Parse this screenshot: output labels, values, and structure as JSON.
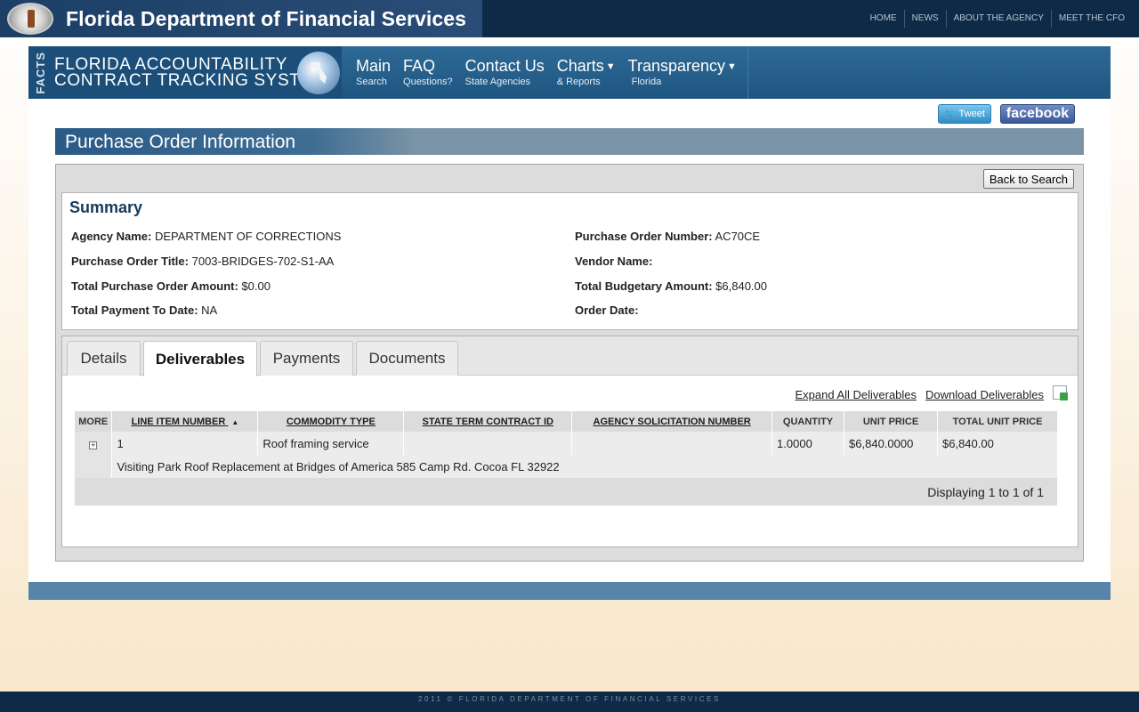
{
  "topbar": {
    "title": "Florida Department of Financial Services",
    "nav": [
      "HOME",
      "NEWS",
      "ABOUT THE AGENCY",
      "MEET THE CFO"
    ]
  },
  "facts": {
    "vertical_label": "FACTS",
    "title_line1": "FLORIDA ACCOUNTABILITY",
    "title_line2": "CONTRACT TRACKING SYSTEM"
  },
  "mainnav": [
    {
      "label": "Main",
      "sub": "Search"
    },
    {
      "label": "FAQ",
      "sub": "Questions?"
    },
    {
      "label": "Contact Us",
      "sub": "State Agencies"
    },
    {
      "label": "Charts",
      "sub": "& Reports"
    },
    {
      "label": "Transparency",
      "sub": "Florida"
    }
  ],
  "social": {
    "tweet": "Tweet",
    "facebook": "facebook"
  },
  "page_title": "Purchase Order Information",
  "back_button": "Back to Search",
  "summary": {
    "heading": "Summary",
    "agency_name_label": "Agency Name:",
    "agency_name": "DEPARTMENT OF CORRECTIONS",
    "po_number_label": "Purchase Order Number:",
    "po_number": "AC70CE",
    "po_title_label": "Purchase Order Title:",
    "po_title": "7003-BRIDGES-702-S1-AA",
    "vendor_label": "Vendor Name:",
    "vendor": "",
    "total_amount_label": "Total Purchase Order Amount:",
    "total_amount": "$0.00",
    "budgetary_label": "Total Budgetary Amount:",
    "budgetary": "$6,840.00",
    "payment_label": "Total Payment To Date:",
    "payment": "NA",
    "order_date_label": "Order Date:",
    "order_date": ""
  },
  "tabs": [
    "Details",
    "Deliverables",
    "Payments",
    "Documents"
  ],
  "active_tab": "Deliverables",
  "deliverables": {
    "expand_all": "Expand All Deliverables",
    "download": "Download Deliverables",
    "columns": [
      "MORE",
      "LINE ITEM NUMBER",
      "COMMODITY TYPE",
      "STATE TERM CONTRACT ID",
      "AGENCY SOLICITATION NUMBER",
      "QUANTITY",
      "UNIT PRICE",
      "TOTAL UNIT PRICE"
    ],
    "sort_indicator": "▲",
    "rows": [
      {
        "expand": "+",
        "line_item": "1",
        "commodity": "Roof framing service",
        "state_term": "",
        "agency_solicitation": "",
        "quantity": "1.0000",
        "unit_price": "$6,840.0000",
        "total_unit_price": "$6,840.00",
        "description": "Visiting Park Roof Replacement at Bridges of America 585 Camp Rd. Cocoa FL 32922"
      }
    ],
    "pager": "Displaying 1 to 1 of 1"
  },
  "footer": "2011 © FLORIDA DEPARTMENT OF FINANCIAL SERVICES"
}
